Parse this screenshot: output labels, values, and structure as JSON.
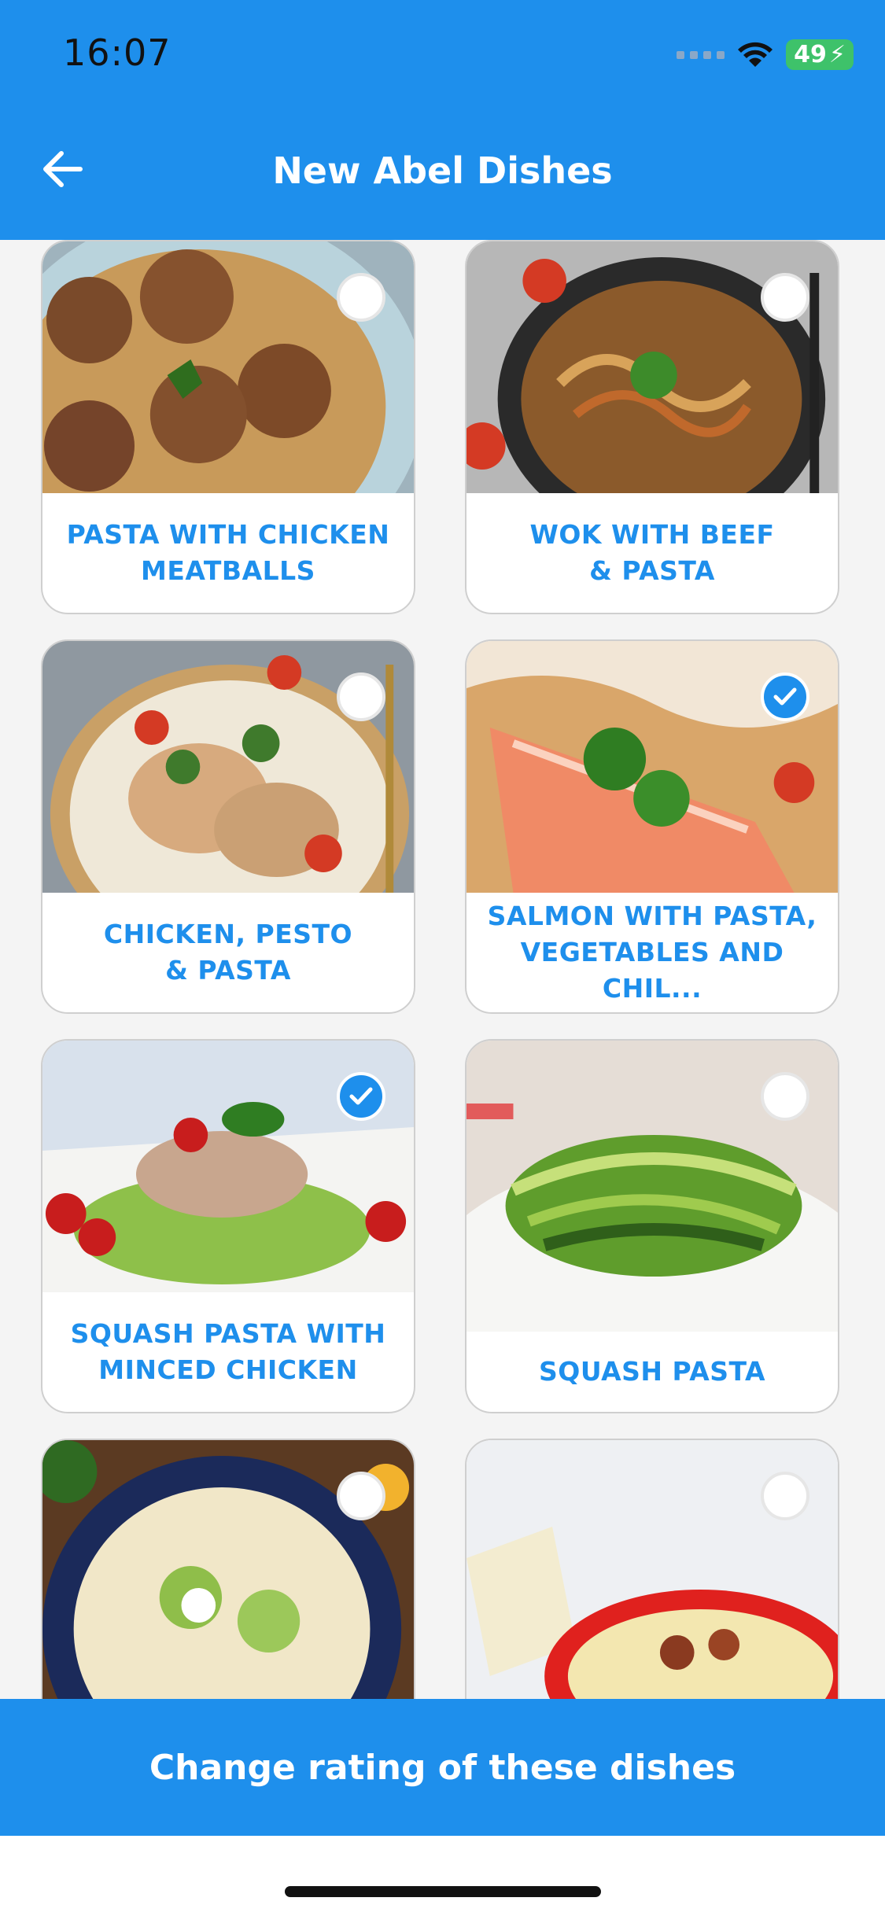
{
  "status_bar": {
    "time": "16:07",
    "battery": "49"
  },
  "header": {
    "title": "New Abel Dishes"
  },
  "dishes": [
    {
      "name": "PASTA WITH CHICKEN MEATBALLS",
      "line1": "PASTA WITH CHICKEN",
      "line2": "MEATBALLS",
      "selected": false
    },
    {
      "name": "WOK WITH BEEF & PASTA",
      "line1": "WOK WITH BEEF",
      "line2": "& PASTA",
      "selected": false
    },
    {
      "name": "CHICKEN, PESTO & PASTA",
      "line1": "CHICKEN, PESTO",
      "line2": "& PASTA",
      "selected": false
    },
    {
      "name": "SALMON WITH PASTA, VEGETABLES AND CHIL...",
      "line1": "SALMON WITH PASTA,",
      "line2": "VEGETABLES AND CHIL...",
      "selected": true
    },
    {
      "name": "SQUASH PASTA WITH MINCED CHICKEN",
      "line1": "SQUASH PASTA WITH",
      "line2": "MINCED CHICKEN",
      "selected": true
    },
    {
      "name": "SQUASH PASTA",
      "line1": "SQUASH PASTA",
      "line2": "",
      "selected": false
    },
    {
      "name": "",
      "line1": "",
      "line2": "",
      "selected": false
    },
    {
      "name": "",
      "line1": "",
      "line2": "",
      "selected": false
    }
  ],
  "footer": {
    "cta_label": "Change rating of these dishes"
  },
  "colors": {
    "accent": "#1e8fec",
    "battery": "#3ec26a"
  }
}
